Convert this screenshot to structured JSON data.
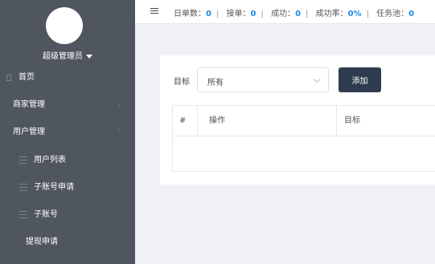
{
  "sidebar": {
    "username": "超级管理员",
    "items": [
      {
        "label": "首页"
      },
      {
        "label": "商家管理"
      },
      {
        "label": "用户管理"
      },
      {
        "label": "用户列表"
      },
      {
        "label": "子账号申请"
      },
      {
        "label": "子账号"
      },
      {
        "label": "提现申请"
      }
    ]
  },
  "topbar": {
    "stats": [
      {
        "label": "日单数：",
        "value": "0"
      },
      {
        "label": "接单：",
        "value": "0"
      },
      {
        "label": "成功：",
        "value": "0"
      },
      {
        "label": "成功率：",
        "value": "0%"
      },
      {
        "label": "任务池：",
        "value": "0"
      }
    ]
  },
  "filter": {
    "label": "目标",
    "selected": "所有",
    "add_label": "添加"
  },
  "table": {
    "columns": [
      "#",
      "操作",
      "目标"
    ]
  },
  "colors": {
    "sidebar_bg": "#50565f",
    "accent": "#1e88e5",
    "button_bg": "#2f3c4f"
  }
}
